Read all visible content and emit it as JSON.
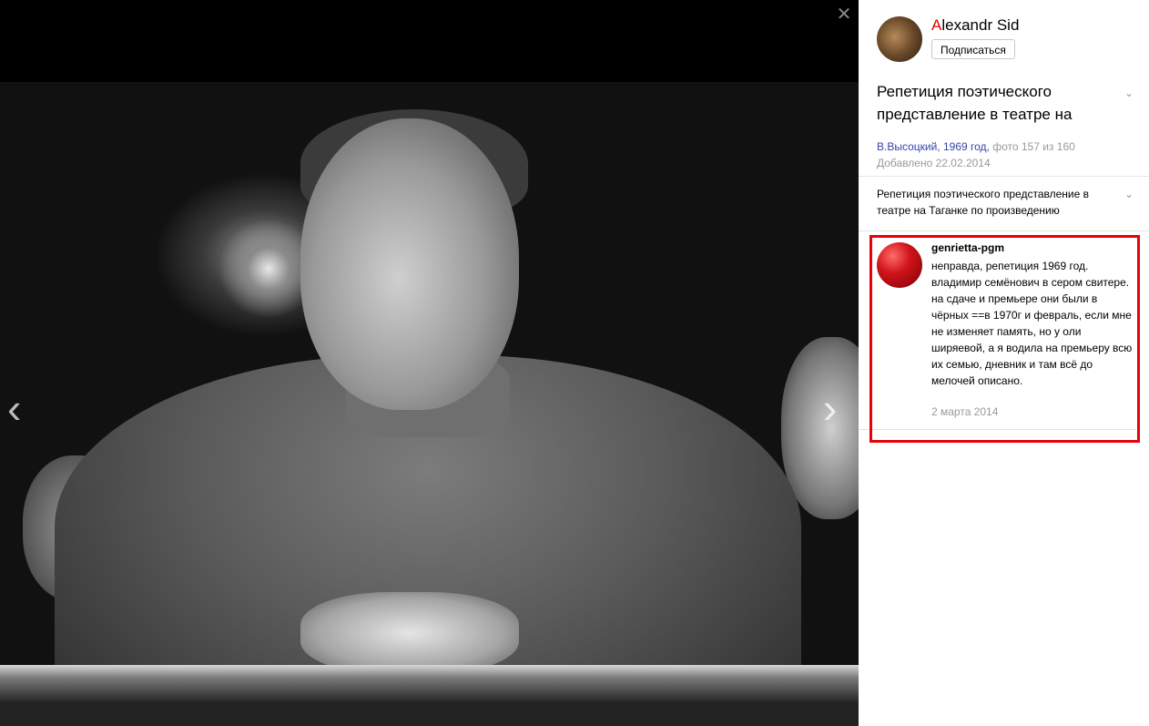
{
  "author": {
    "name_first_letter": "A",
    "name_rest": "lexandr Sid",
    "subscribe_label": "Подписаться"
  },
  "photo": {
    "title": "Репетиция поэтического представление в театре на",
    "album_link": "В.Высоцкий, 1969 год,",
    "counter": "фото 157 из 160",
    "added": "Добавлено 22.02.2014",
    "description": "Репетиция поэтического представление в театре на Таганке по произведению"
  },
  "comment": {
    "author": "genrietta-pgm",
    "text": "неправда, репетиция 1969 год. владимир семёнович в сером свитере. на сдаче и премьере они были в чёрных ==в 1970г и февраль, если мне не изменяет память, но у оли ширяевой, а я водила на премьеру всю их семью, дневник и там всё до мелочей описано.",
    "date": "2 марта 2014"
  },
  "icons": {
    "close": "close-icon",
    "prev": "chevron-left-icon",
    "next": "chevron-right-icon",
    "expand": "chevron-down-icon"
  },
  "colors": {
    "author_accent": "#e00000",
    "link": "#3344aa",
    "highlight_border": "#e8000b"
  }
}
